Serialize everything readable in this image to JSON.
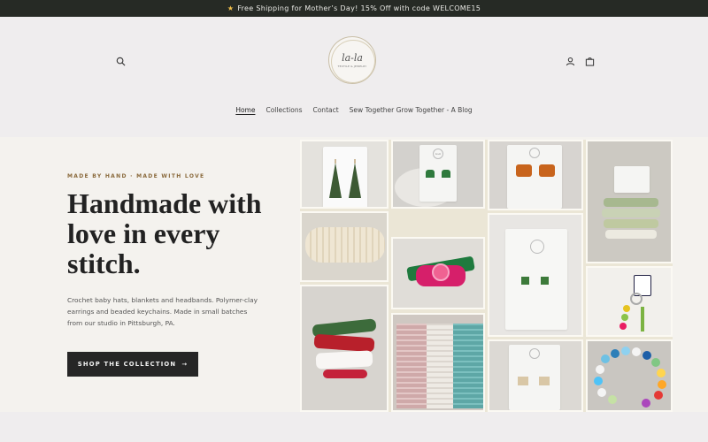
{
  "announcement": {
    "icon": "star-icon",
    "text": "Free Shipping for Mother’s Day! 15% Off with code WELCOME15"
  },
  "brand": {
    "name": "la-la",
    "tagline": "TEXTILE & JEWELRY"
  },
  "header_icons": [
    "search-icon",
    "account-icon",
    "cart-icon"
  ],
  "nav": {
    "items": [
      {
        "label": "Home",
        "active": true
      },
      {
        "label": "Collections",
        "active": false
      },
      {
        "label": "Contact",
        "active": false
      },
      {
        "label": "Sew Together Grow Together - A Blog",
        "active": false
      }
    ]
  },
  "hero": {
    "eyebrow": "MADE BY HAND · MADE WITH LOVE",
    "headline": "Handmade with love in every stitch.",
    "description": "Crochet baby hats, blankets and headbands. Polymer-clay earrings and beaded keychains. Made in small batches from our studio in Pittsburgh, PA.",
    "cta_label": "SHOP THE COLLECTION",
    "cta_arrow": "→"
  },
  "collage": {
    "photos": [
      "tree-earrings-photo",
      "green-heart-earrings-photo",
      "orange-sweater-earrings-photo",
      "bow-headbands-photo",
      "cream-knit-headband-photo",
      "pink-flower-bow-photo",
      "sweater-earrings-card-photo",
      "keychain-beaded-photo",
      "red-white-bows-photo",
      "crochet-blankets-photo",
      "mini-sweater-earrings-photo",
      "silicone-bead-bracelet-photo"
    ],
    "card_logo_text": "la-la"
  },
  "colors": {
    "announce_bg": "#262a25",
    "header_bg": "#efedee",
    "hero_bg": "#f4f2ee",
    "cta_bg": "#262626",
    "eyebrow": "#8a6a3c"
  }
}
